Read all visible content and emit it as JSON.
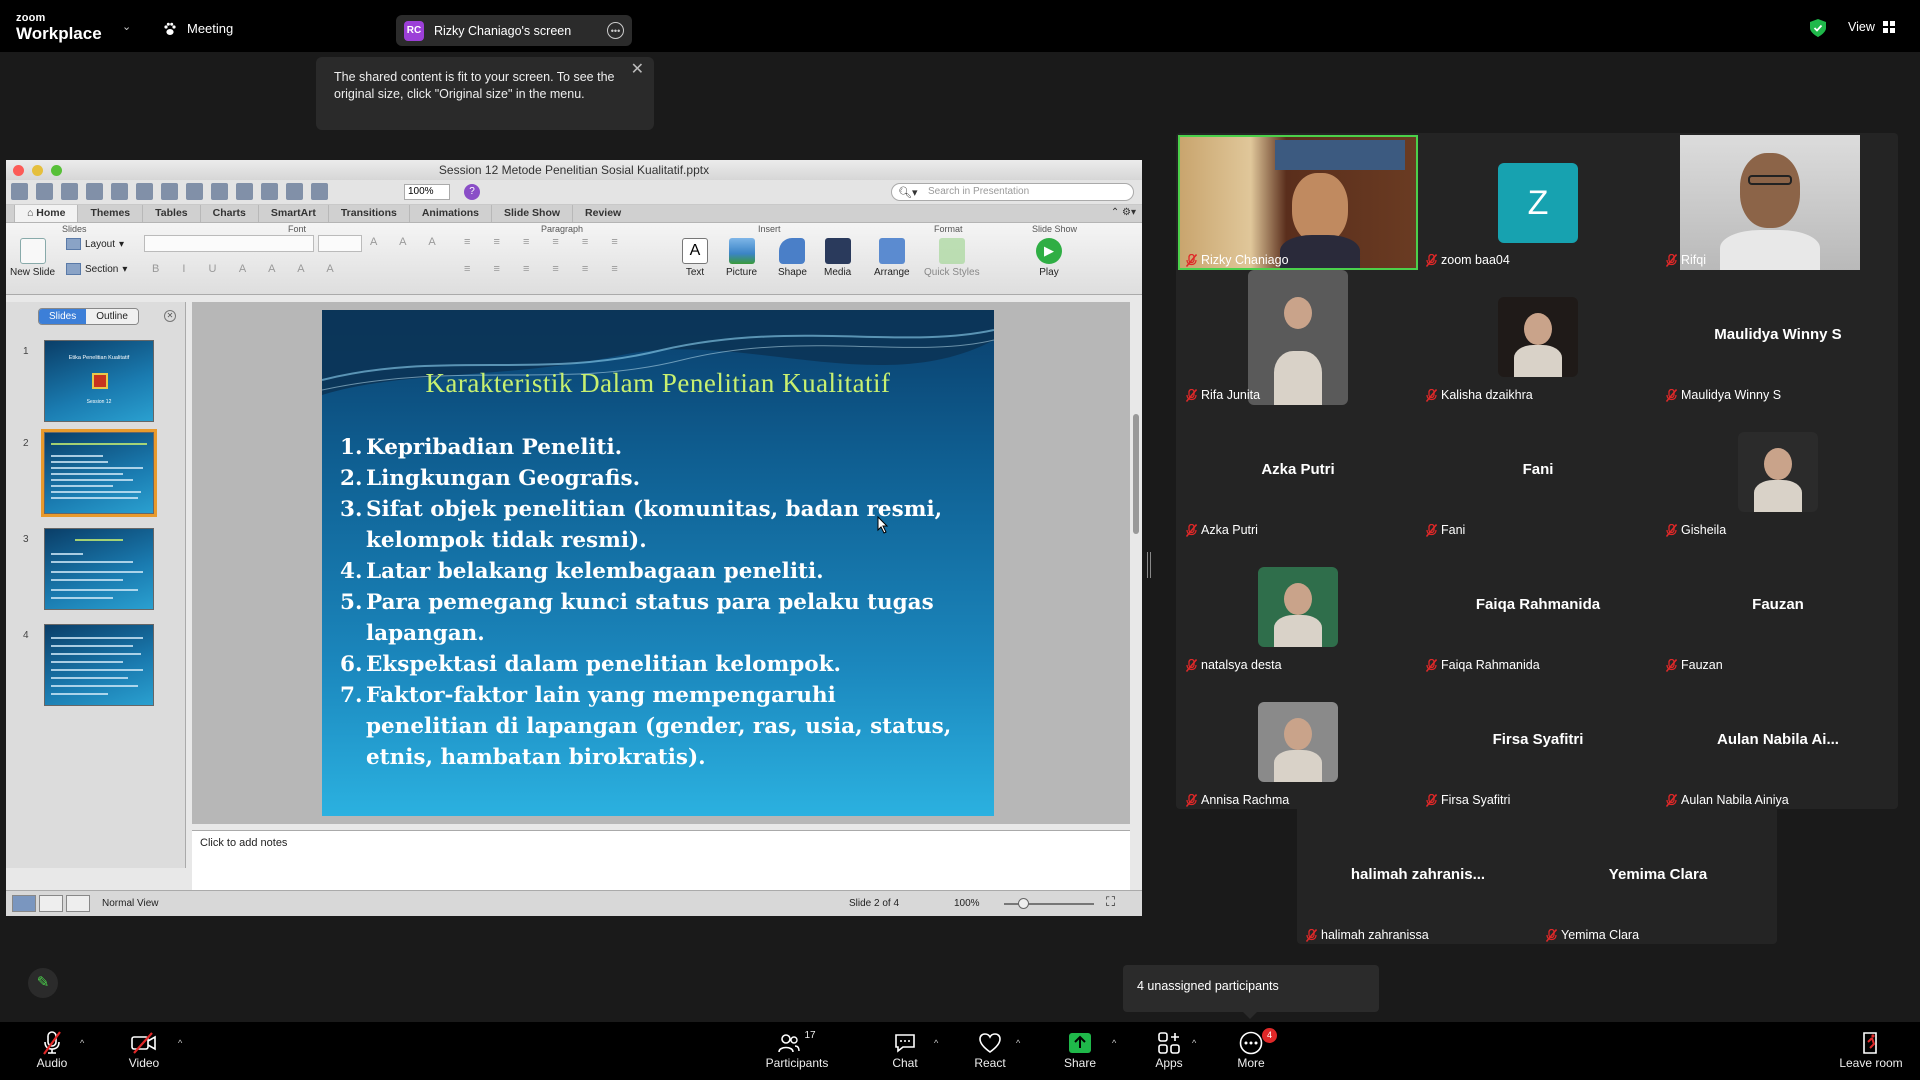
{
  "topbar": {
    "logo_line1": "zoom",
    "logo_line2": "Workplace",
    "meeting_label": "Meeting",
    "screen_initials": "RC",
    "screen_label": "Rizky Chaniago's screen",
    "view_label": "View"
  },
  "tooltip": {
    "text": "The shared content is fit to your screen. To see the original size, click \"Original size\" in the menu."
  },
  "ppt": {
    "window_title": "Session 12 Metode Penelitian Sosial Kualitatif.pptx",
    "zoom_value": "100%",
    "search_placeholder": "Search in Presentation",
    "tabs": [
      "Home",
      "Themes",
      "Tables",
      "Charts",
      "SmartArt",
      "Transitions",
      "Animations",
      "Slide Show",
      "Review"
    ],
    "groups": {
      "slides": "Slides",
      "font": "Font",
      "paragraph": "Paragraph",
      "insert": "Insert",
      "format": "Format",
      "slideshow": "Slide Show"
    },
    "buttons": {
      "new_slide": "New Slide",
      "layout": "Layout",
      "section": "Section",
      "text": "Text",
      "picture": "Picture",
      "shape": "Shape",
      "media": "Media",
      "arrange": "Arrange",
      "quick_styles": "Quick Styles",
      "play": "Play"
    },
    "pane_tabs": [
      "Slides",
      "Outline"
    ],
    "slide_numbers": [
      "1",
      "2",
      "3",
      "4"
    ],
    "thumb1_title": "Etika Penelitian Kualitatif",
    "thumb1_sub": "Session 12",
    "slide": {
      "title": "Karakteristik Dalam Penelitian Kualitatif",
      "items": [
        {
          "n": "1.",
          "lines": [
            "Kepribadian Peneliti."
          ]
        },
        {
          "n": "2.",
          "lines": [
            "Lingkungan Geografis."
          ]
        },
        {
          "n": "3.",
          "lines": [
            "Sifat objek penelitian (komunitas, badan resmi,",
            "kelompok tidak  resmi)."
          ]
        },
        {
          "n": "4.",
          "lines": [
            "Latar belakang kelembagaan peneliti."
          ]
        },
        {
          "n": "5.",
          "lines": [
            "Para pemegang kunci status para pelaku tugas",
            "lapangan."
          ]
        },
        {
          "n": "6.",
          "lines": [
            "Ekspektasi dalam penelitian kelompok."
          ]
        },
        {
          "n": "7.",
          "lines": [
            "Faktor-faktor lain yang mempengaruhi",
            "penelitian  di lapangan (gender, ras, usia, status,",
            "etnis, hambatan birokratis)."
          ]
        }
      ]
    },
    "notes_placeholder": "Click to add notes",
    "status": {
      "view": "Normal View",
      "slide_of": "Slide 2 of 4",
      "zoom": "100%"
    }
  },
  "participants": [
    {
      "name": "Rizky Chaniago",
      "kind": "video"
    },
    {
      "name": "zoom baa04",
      "kind": "avatar",
      "initial": "Z"
    },
    {
      "name": "Rifqi",
      "kind": "video"
    },
    {
      "name": "Rifa Junita",
      "kind": "photo"
    },
    {
      "name": "Kalisha dzaikhra",
      "kind": "photo"
    },
    {
      "name": "Maulidya Winny S",
      "kind": "text",
      "display": "Maulidya Winny S"
    },
    {
      "name": "Azka Putri",
      "kind": "text",
      "display": "Azka Putri"
    },
    {
      "name": "Fani",
      "kind": "text",
      "display": "Fani"
    },
    {
      "name": "Gisheila",
      "kind": "photo"
    },
    {
      "name": "natalsya desta",
      "kind": "photo"
    },
    {
      "name": "Faiqa Rahmanida",
      "kind": "text",
      "display": "Faiqa Rahmanida"
    },
    {
      "name": "Fauzan",
      "kind": "text",
      "display": "Fauzan"
    },
    {
      "name": "Annisa Rachma",
      "kind": "photo"
    },
    {
      "name": "Firsa Syafitri",
      "kind": "text",
      "display": "Firsa Syafitri"
    },
    {
      "name": "Aulan Nabila Ainiya",
      "kind": "text",
      "display": "Aulan  Nabila Ai..."
    },
    {
      "name": "halimah zahranissa",
      "kind": "text",
      "display": "halimah  zahranis..."
    },
    {
      "name": "Yemima Clara",
      "kind": "text",
      "display": "Yemima Clara"
    }
  ],
  "unassigned": "4 unassigned participants",
  "bottombar": {
    "audio": "Audio",
    "video": "Video",
    "participants": "Participants",
    "participants_count": "17",
    "chat": "Chat",
    "react": "React",
    "share": "Share",
    "apps": "Apps",
    "more": "More",
    "more_badge": "4",
    "leave": "Leave room"
  },
  "colors": {
    "accent_green": "#4bd04b",
    "mute_red": "#e02828",
    "slide_title": "#c8f070"
  }
}
